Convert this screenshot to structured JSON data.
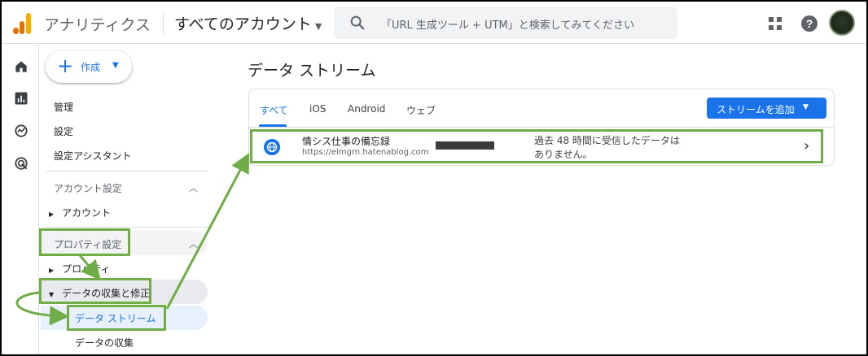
{
  "header": {
    "app_name": "アナリティクス",
    "account_selector": "すべてのアカウント",
    "search_placeholder": "「URL 生成ツール + UTM」と検索してみてください"
  },
  "nav": {
    "create_label": "作成",
    "items": {
      "admin": "管理",
      "settings": "設定",
      "setup_assistant": "設定アシスタント"
    },
    "account_section": {
      "title": "アカウント設定",
      "account": "アカウント"
    },
    "property_section": {
      "title": "プロパティ設定",
      "property": "プロパティ",
      "data_collection_modification": "データの収集と修正",
      "data_streams": "データ ストリーム",
      "data_collection": "データの収集"
    }
  },
  "main": {
    "title": "データ ストリーム",
    "tabs": [
      {
        "label": "すべて",
        "active": true
      },
      {
        "label": "iOS",
        "active": false
      },
      {
        "label": "Android",
        "active": false
      },
      {
        "label": "ウェブ",
        "active": false
      }
    ],
    "add_stream_label": "ストリームを追加",
    "stream": {
      "name": "情シス仕事の備忘録",
      "url": "https://elmgrn.hatenablog.com",
      "status_line1": "過去 48 時間に受信したデータは",
      "status_line2": "ありません。"
    }
  },
  "colors": {
    "accent": "#1a73e8",
    "annotation_green": "#70ad47",
    "logo_orange": "#e37400",
    "logo_yellow": "#f9ab00"
  }
}
